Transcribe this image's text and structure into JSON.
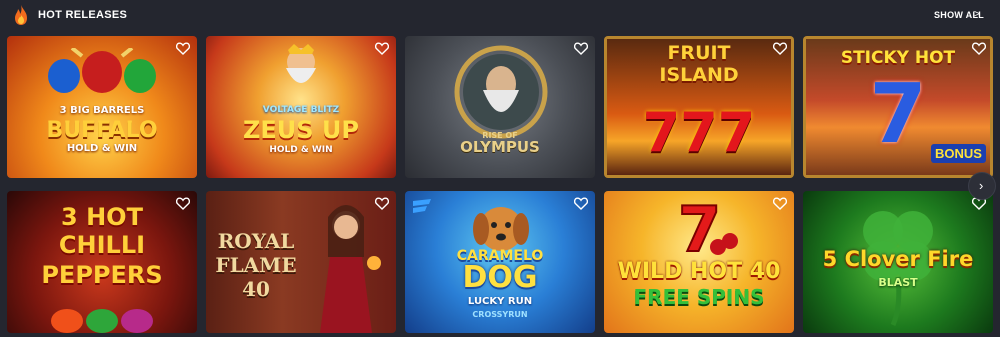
{
  "header": {
    "title": "HOT RELEASES",
    "show_all": "SHOW ALL",
    "show_all_chevron": ">"
  },
  "nav": {
    "next_symbol": "›"
  },
  "games": [
    {
      "lines": [
        "3 BIG BARRELS",
        "BUFFALO",
        "HOLD & WIN"
      ]
    },
    {
      "lines": [
        "VOLTAGE BLITZ",
        "ZEUS UP",
        "HOLD & WIN"
      ]
    },
    {
      "lines": [
        "RISE OF",
        "OLYMPUS"
      ]
    },
    {
      "lines": [
        "FRUIT",
        "ISLAND",
        "777"
      ]
    },
    {
      "lines": [
        "STICKY HOT",
        "7",
        "BONUS"
      ]
    },
    {
      "lines": [
        "3 HOT",
        "CHILLI",
        "PEPPERS"
      ]
    },
    {
      "lines": [
        "ROYAL",
        "FLAME",
        "40"
      ]
    },
    {
      "lines": [
        "CARAMELO",
        "DOG",
        "LUCKY RUN",
        "CROSSYRUN"
      ]
    },
    {
      "lines": [
        "WILD HOT 40",
        "FREE SPINS"
      ]
    },
    {
      "lines": [
        "5 Clover Fire",
        "BLAST"
      ]
    }
  ]
}
